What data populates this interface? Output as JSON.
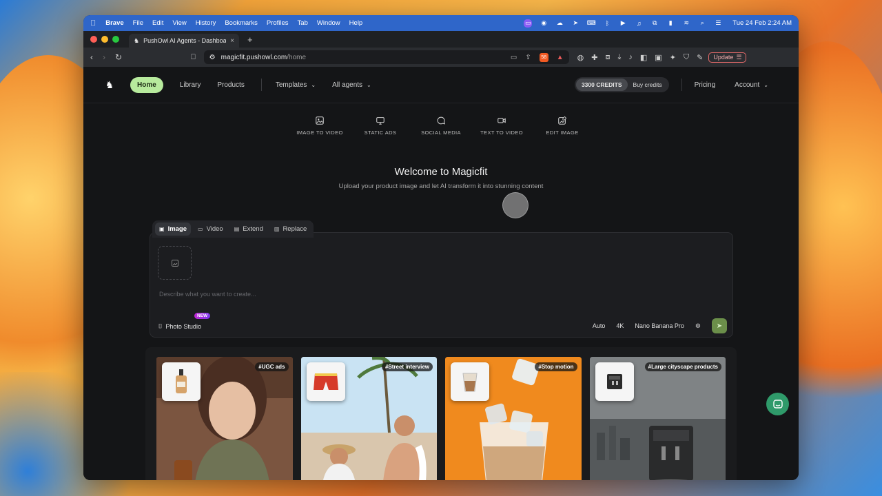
{
  "menubar": {
    "app": "Brave",
    "items": [
      "File",
      "Edit",
      "View",
      "History",
      "Bookmarks",
      "Profiles",
      "Tab",
      "Window",
      "Help"
    ],
    "clock": "Tue 24 Feb  2:24 AM"
  },
  "tab": {
    "title": "PushOwl AI Agents - Dashboard",
    "close": "×",
    "new_tab": "+"
  },
  "toolbar": {
    "url_host": "magicfit.pushowl.com",
    "url_path": "/home",
    "update_label": "Update",
    "brave_badge": "58"
  },
  "appnav": {
    "home": "Home",
    "library": "Library",
    "products": "Products",
    "templates": "Templates",
    "all_agents": "All agents",
    "credits": "3300 CREDITS",
    "buy_credits": "Buy credits",
    "pricing": "Pricing",
    "account": "Account"
  },
  "modes": [
    {
      "label": "IMAGE TO VIDEO",
      "icon": "image-icon"
    },
    {
      "label": "STATIC ADS",
      "icon": "monitor-icon"
    },
    {
      "label": "SOCIAL MEDIA",
      "icon": "chat-icon"
    },
    {
      "label": "TEXT TO VIDEO",
      "icon": "video-camera-icon"
    },
    {
      "label": "EDIT IMAGE",
      "icon": "edit-image-icon"
    }
  ],
  "hero": {
    "title": "Welcome to Magicfit",
    "subtitle": "Upload your product image and let AI transform it into stunning content"
  },
  "composer": {
    "tabs": [
      "Image",
      "Video",
      "Extend",
      "Replace"
    ],
    "active_tab": "Image",
    "prompt_placeholder": "Describe what you want to create...",
    "photo_studio": "Photo Studio",
    "new_badge": "NEW",
    "aspect": "Auto",
    "resolution": "4K",
    "model": "Nano Banana Pro"
  },
  "gallery": [
    {
      "tag": "#UGC ads"
    },
    {
      "tag": "#Street interview"
    },
    {
      "tag": "#Stop motion"
    },
    {
      "tag": "#Large cityscape products"
    }
  ],
  "colors": {
    "accent_green": "#b7ea9d",
    "send_green": "#6b8f4a",
    "chat_green": "#2f9a6a",
    "menubar_blue": "#2f66c9"
  }
}
